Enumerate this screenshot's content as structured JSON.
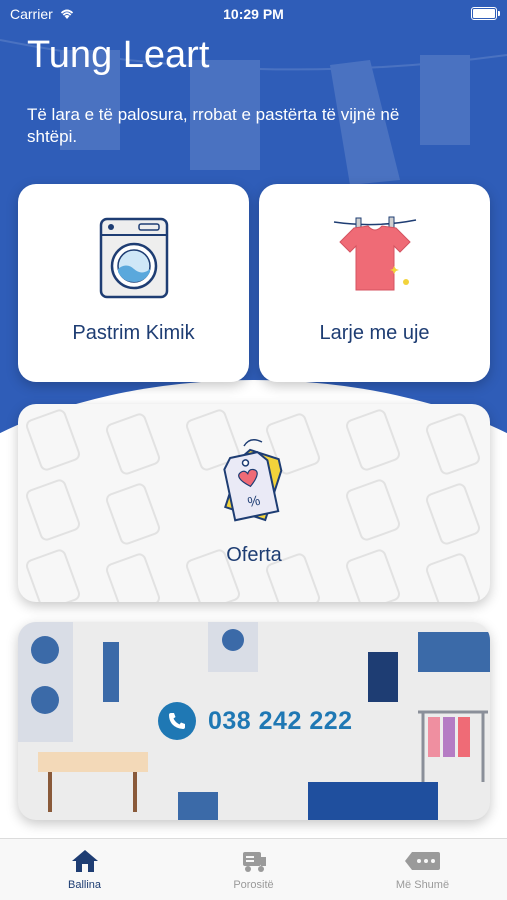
{
  "status_bar": {
    "carrier": "Carrier",
    "time": "10:29 PM"
  },
  "header": {
    "title": "Tung Leart",
    "subtitle": "Të lara e të palosura, rrobat e pastërta të vijnë në shtëpi."
  },
  "services": {
    "dry_cleaning": {
      "label": "Pastrim Kimik",
      "icon": "washing-machine-icon"
    },
    "water_wash": {
      "label": "Larje me uje",
      "icon": "shirt-on-hanger-icon"
    }
  },
  "offers": {
    "label": "Oferta",
    "icon": "price-tag-icon"
  },
  "contact": {
    "phone": "038 242 222",
    "icon": "phone-icon"
  },
  "tabbar": {
    "tabs": [
      {
        "label": "Ballina",
        "icon": "home-icon",
        "active": true
      },
      {
        "label": "Porositë",
        "icon": "delivery-van-icon",
        "active": false
      },
      {
        "label": "Më Shumë",
        "icon": "more-tag-icon",
        "active": false
      }
    ]
  },
  "colors": {
    "primary": "#2f5db8",
    "text_dark": "#1e3d73",
    "phone": "#1f78b4",
    "tab_inactive": "#9a9a9a"
  }
}
